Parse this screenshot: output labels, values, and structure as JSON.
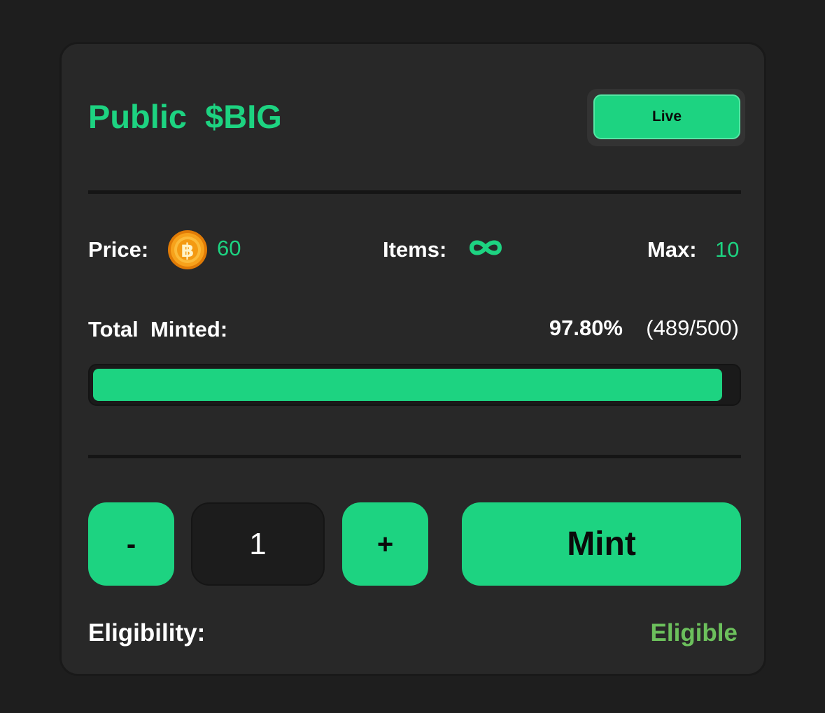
{
  "header": {
    "title": "Public  $BIG",
    "status_label": "Live"
  },
  "stats": {
    "price_label": "Price:",
    "price_icon": "bitcoin-coin-icon",
    "price_value": "60",
    "items_label": "Items:",
    "items_icon": "infinity-icon",
    "max_label": "Max:",
    "max_value": "10"
  },
  "minted": {
    "label": "Total  Minted:",
    "percent_text": "97.80%",
    "count_text": "(489/500)",
    "progress_fraction": 0.978
  },
  "controls": {
    "decrement_label": "-",
    "quantity_value": "1",
    "increment_label": "+",
    "mint_label": "Mint"
  },
  "eligibility": {
    "label": "Eligibility:",
    "value": "Eligible"
  },
  "colors": {
    "accent": "#1dd381",
    "eligible": "#6cc05c",
    "card_background": "#282828",
    "page_background": "#1e1e1e"
  }
}
